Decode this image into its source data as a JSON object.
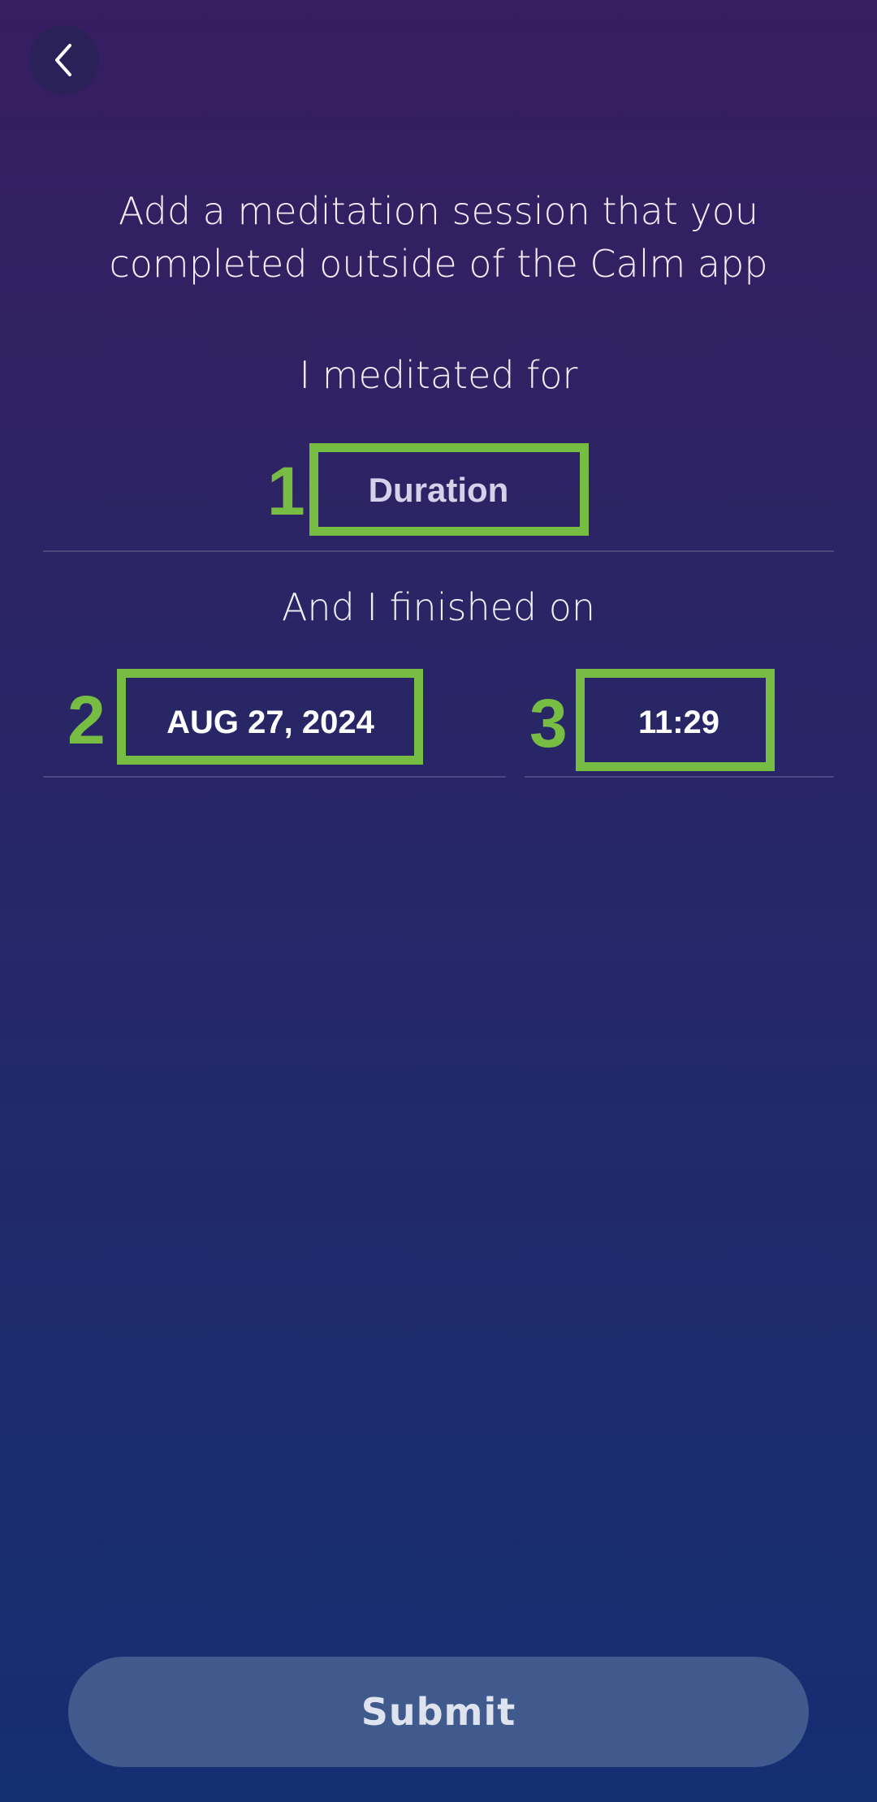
{
  "header": {
    "back_icon": "chevron-left-icon"
  },
  "intro": {
    "text": "Add a meditation session that you completed outside of the Calm app"
  },
  "duration_section": {
    "label": "I meditated for",
    "duration_value": "Duration"
  },
  "finish_section": {
    "label": "And I finished on",
    "date_value": "AUG 27, 2024",
    "time_value": "11:29"
  },
  "annotations": {
    "marker_1": "1",
    "marker_2": "2",
    "marker_3": "3",
    "highlight_color": "#77bd44"
  },
  "footer": {
    "submit_label": "Submit"
  },
  "colors": {
    "background_top": "#371d62",
    "background_bottom": "#142f72",
    "submit_button": "#405a8e"
  }
}
